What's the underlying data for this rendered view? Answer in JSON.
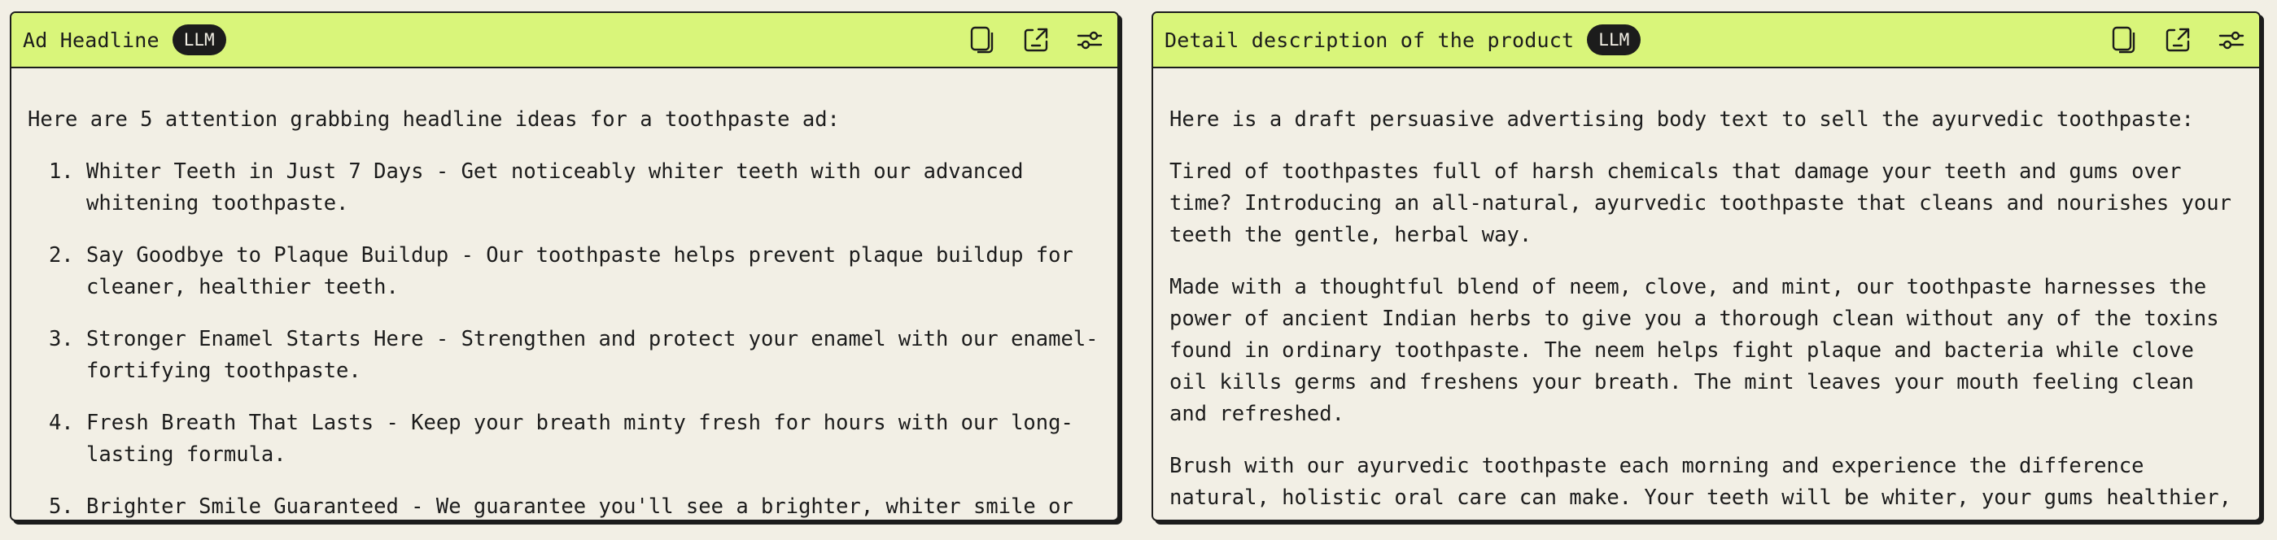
{
  "left_panel": {
    "title": "Ad Headline",
    "badge": "LLM",
    "intro": "Here are 5 attention grabbing headline ideas for a toothpaste ad:",
    "items": [
      "Whiter Teeth in Just 7 Days - Get noticeably whiter teeth with our advanced whitening toothpaste.",
      "Say Goodbye to Plaque Buildup - Our toothpaste helps prevent plaque buildup for cleaner, healthier teeth.",
      "Stronger Enamel Starts Here - Strengthen and protect your enamel with our enamel-fortifying toothpaste.",
      "Fresh Breath That Lasts - Keep your breath minty fresh for hours with our long-lasting formula.",
      "Brighter Smile Guaranteed - We guarantee you'll see a brighter, whiter smile or"
    ]
  },
  "right_panel": {
    "title": "Detail description of the product",
    "badge": "LLM",
    "paragraphs": [
      "Here is a draft persuasive advertising body text to sell the ayurvedic toothpaste:",
      "Tired of toothpastes full of harsh chemicals that damage your teeth and gums over time? Introducing an all-natural, ayurvedic toothpaste that cleans and nourishes your teeth the gentle, herbal way.",
      "Made with a thoughtful blend of neem, clove, and mint, our toothpaste harnesses the power of ancient Indian herbs to give you a thorough clean without any of the toxins found in ordinary toothpaste. The neem helps fight plaque and bacteria while clove oil kills germs and freshens your breath. The mint leaves your mouth feeling clean and refreshed.",
      "Brush with our ayurvedic toothpaste each morning and experience the difference natural, holistic oral care can make. Your teeth will be whiter, your gums healthier, and your"
    ]
  },
  "icons": [
    "copy-icon",
    "export-icon",
    "settings-sliders-icon"
  ],
  "colors": {
    "header_bg": "#d9f57a",
    "page_bg": "#f2efe5",
    "ink": "#1c1c1c"
  }
}
